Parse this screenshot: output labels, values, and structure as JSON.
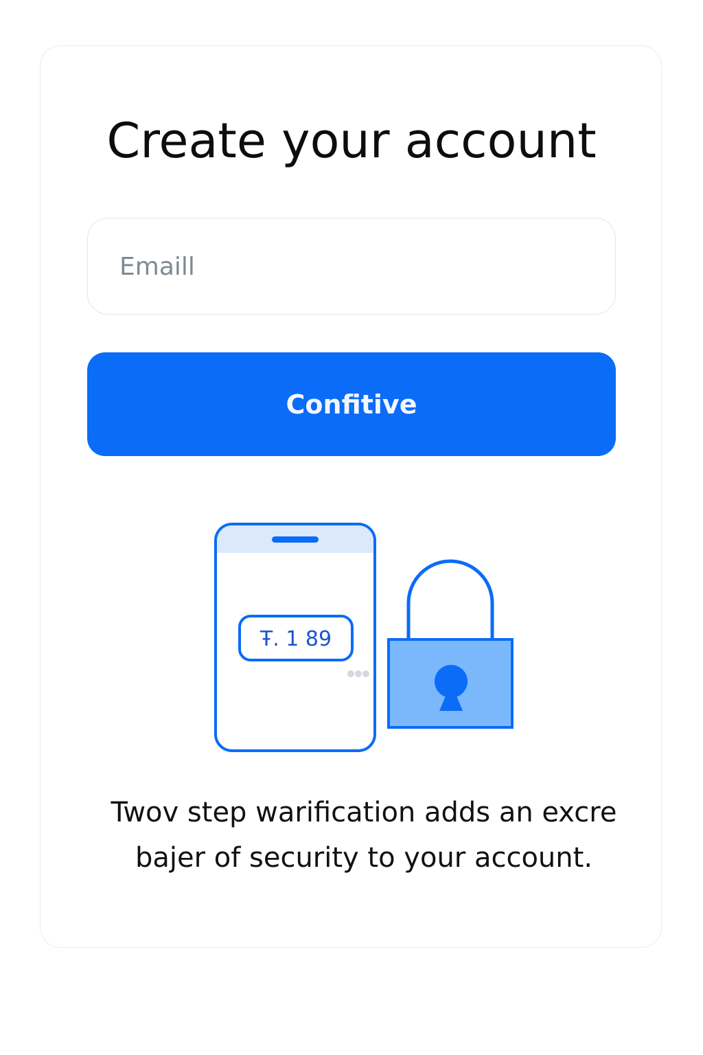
{
  "signup": {
    "title": "Create your account",
    "email_placeholder": "Emaill",
    "continue_label": "Confitive"
  },
  "illustration": {
    "code_text": "Ŧ. 1 89",
    "phone_icon": "phone-icon",
    "lock_icon": "padlock-icon"
  },
  "caption": {
    "line1": "Twov step warification adds an excre",
    "line2": "bajer of security to your account."
  },
  "colors": {
    "accent": "#0b6cf7",
    "lock_fill": "#7ab8fb",
    "phone_header": "#dbe9fb"
  }
}
